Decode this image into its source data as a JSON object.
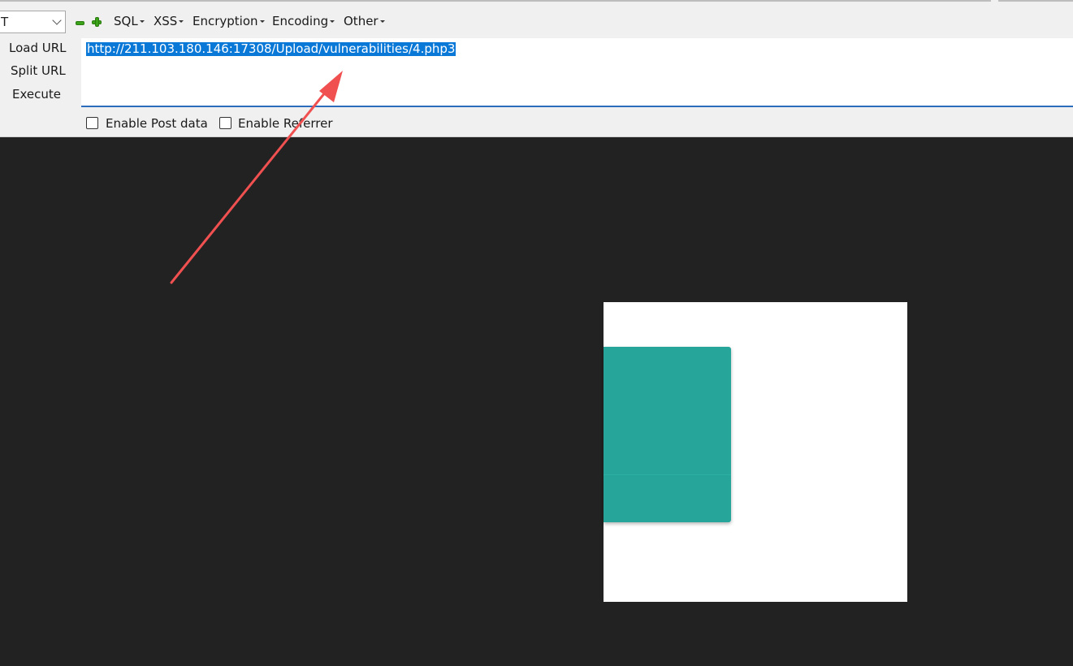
{
  "toolbar": {
    "method": "T",
    "menus": [
      "SQL",
      "XSS",
      "Encryption",
      "Encoding",
      "Other"
    ],
    "icons": {
      "minus": "minus-icon",
      "plus": "plus-icon"
    }
  },
  "side_buttons": {
    "load_url": "Load URL",
    "split_url": "Split URL",
    "execute": "Execute"
  },
  "url": {
    "value": "http://211.103.180.146:17308/Upload/vulnerabilities/4.php3"
  },
  "options": {
    "post_data": "Enable Post data",
    "referrer": "Enable Referrer"
  },
  "colors": {
    "page_background": "#222222",
    "accent": "#26a69a",
    "selection": "#0a78d7",
    "annotation_arrow": "#f05050"
  }
}
